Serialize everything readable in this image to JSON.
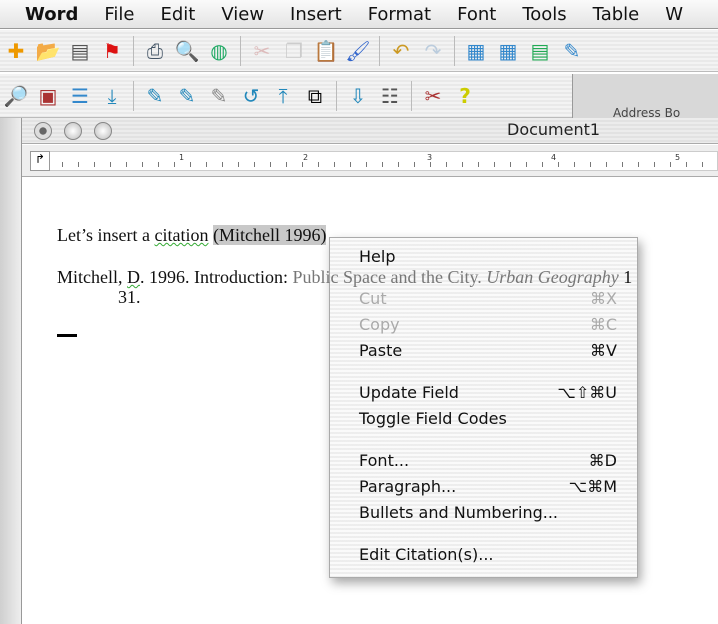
{
  "menubar": {
    "items": [
      "Word",
      "File",
      "Edit",
      "View",
      "Insert",
      "Format",
      "Font",
      "Tools",
      "Table",
      "W"
    ]
  },
  "window": {
    "title": "Document1",
    "palette_label": "Address Bo"
  },
  "ruler": {
    "numbers": [
      "1",
      "2",
      "3",
      "4",
      "5"
    ]
  },
  "document": {
    "line1_before": "Let’s insert a ",
    "line1_squig": "citation",
    "line1_sel": "(Mitchell 1996)",
    "ref_a": "Mitchell",
    "ref_b": ", ",
    "ref_c": "D",
    "ref_d": ". 1996. Introduction: ",
    "ref_e": "Public Space and the City. ",
    "ref_f": "Urban Geography",
    " ref_g": "",
    "ref_end": " 1",
    "ref_line2": "31."
  },
  "context_menu": {
    "items": [
      {
        "label": "Help",
        "shortcut": "",
        "disabled": false
      },
      {
        "label": "Cut",
        "shortcut": "⌘X",
        "disabled": true
      },
      {
        "label": "Copy",
        "shortcut": "⌘C",
        "disabled": true
      },
      {
        "label": "Paste",
        "shortcut": "⌘V",
        "disabled": false
      },
      {
        "label": "Update Field",
        "shortcut": "⌥⇧⌘U",
        "disabled": false
      },
      {
        "label": "Toggle Field Codes",
        "shortcut": "",
        "disabled": false
      },
      {
        "label": "Font...",
        "shortcut": "⌘D",
        "disabled": false
      },
      {
        "label": "Paragraph...",
        "shortcut": "⌥⌘M",
        "disabled": false
      },
      {
        "label": "Bullets and Numbering...",
        "shortcut": "",
        "disabled": false
      },
      {
        "label": "Edit Citation(s)...",
        "shortcut": "",
        "disabled": false
      }
    ]
  }
}
